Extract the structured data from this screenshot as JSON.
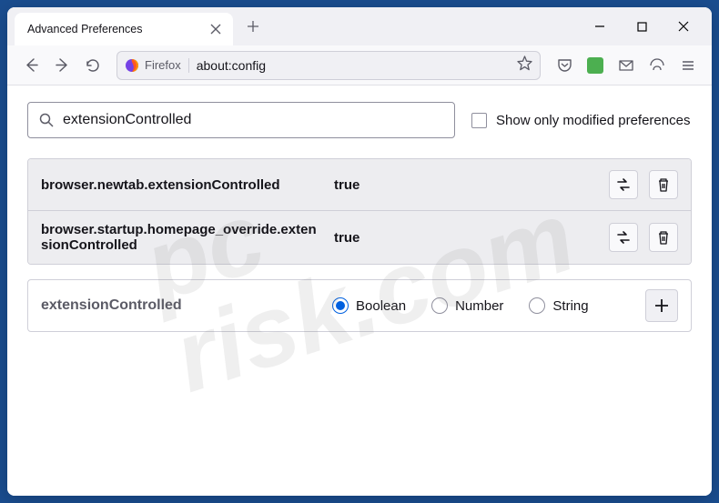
{
  "tab": {
    "title": "Advanced Preferences"
  },
  "urlbar": {
    "identity": "Firefox",
    "url": "about:config"
  },
  "search": {
    "value": "extensionControlled"
  },
  "filter": {
    "label": "Show only modified preferences"
  },
  "prefs": [
    {
      "name": "browser.newtab.extensionControlled",
      "value": "true"
    },
    {
      "name": "browser.startup.homepage_override.extensionControlled",
      "value": "true"
    }
  ],
  "newpref": {
    "name": "extensionControlled",
    "options": [
      "Boolean",
      "Number",
      "String"
    ],
    "selected": "Boolean"
  },
  "watermark": {
    "line1": "pc",
    "line2": "risk.com"
  }
}
